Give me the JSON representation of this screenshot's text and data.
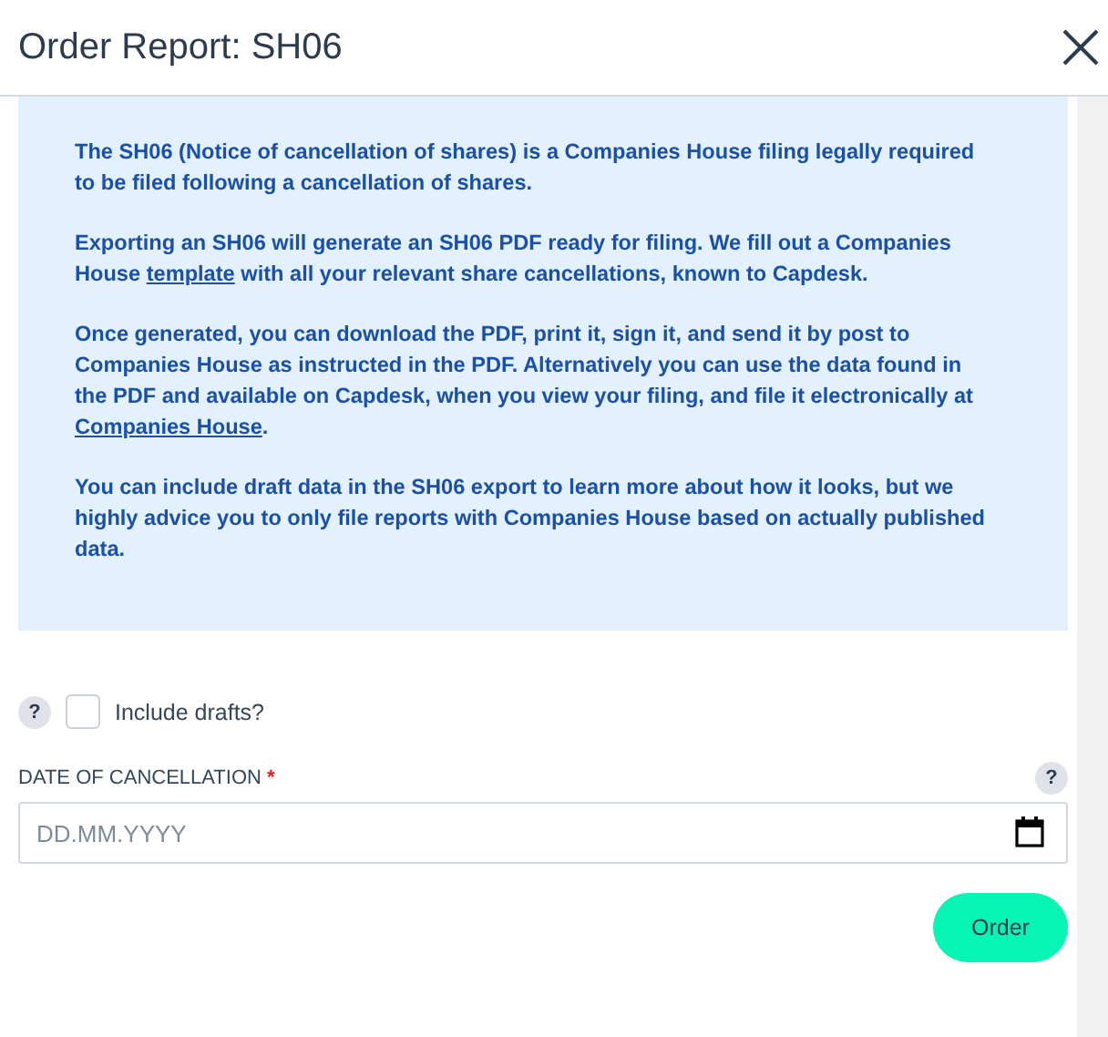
{
  "dialog": {
    "title": "Order Report: SH06"
  },
  "info_paragraphs": [
    [
      {
        "text": "The SH06 (Notice of cancellation of shares) is a Companies House filing legally required to be filed following a cancellation of shares.",
        "kind": "text"
      }
    ],
    [
      {
        "text": "Exporting an SH06 will generate an SH06 PDF ready for filing. We fill out a Companies House ",
        "kind": "text"
      },
      {
        "text": "template",
        "kind": "link"
      },
      {
        "text": " with all your relevant share cancellations, known to Capdesk.",
        "kind": "text"
      }
    ],
    [
      {
        "text": "Once generated, you can download the PDF, print it, sign it, and send it by post to Companies House as instructed in the PDF. Alternatively you can use the data found in the PDF and available on Capdesk, when you view your filing, and file it electronically at ",
        "kind": "text"
      },
      {
        "text": "Companies House",
        "kind": "link"
      },
      {
        "text": ".",
        "kind": "text"
      }
    ],
    [
      {
        "text": "You can include draft data in the SH06 export to learn more about how it looks, but we highly advice you to only file reports with Companies House based on actually published data.",
        "kind": "text"
      }
    ]
  ],
  "include_drafts": {
    "help": "?",
    "label": "Include drafts?",
    "checked": false
  },
  "date_field": {
    "label": "DATE OF CANCELLATION",
    "required_mark": "*",
    "help": "?",
    "placeholder": "DD.MM.YYYY"
  },
  "order_button": {
    "label": "Order"
  }
}
